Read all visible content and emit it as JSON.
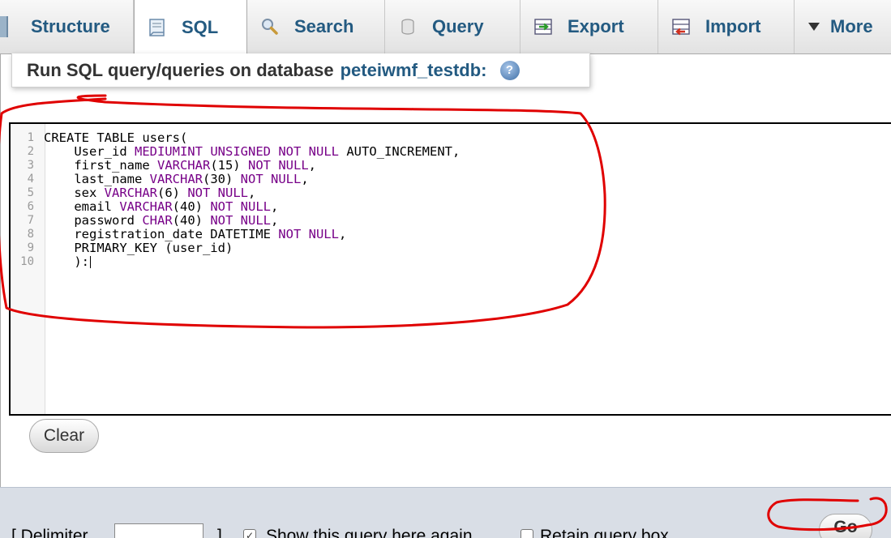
{
  "tabs": [
    {
      "label": "Structure",
      "icon": "table-structure-icon"
    },
    {
      "label": "SQL",
      "icon": "sql-document-icon",
      "active": true
    },
    {
      "label": "Search",
      "icon": "magnifier-icon"
    },
    {
      "label": "Query",
      "icon": "database-query-icon"
    },
    {
      "label": "Export",
      "icon": "export-icon"
    },
    {
      "label": "Import",
      "icon": "import-icon"
    },
    {
      "label": "More",
      "icon": "triangle-down-icon"
    }
  ],
  "heading": {
    "prefix": "Run SQL query/queries on database",
    "database": "peteiwmf_testdb:"
  },
  "editor": {
    "line_numbers": [
      "1",
      "2",
      "3",
      "4",
      "5",
      "6",
      "7",
      "8",
      "9",
      "10"
    ],
    "lines": [
      "CREATE TABLE users(",
      "    User_id MEDIUMINT UNSIGNED NOT NULL AUTO_INCREMENT,",
      "    first_name VARCHAR(15) NOT NULL,",
      "    last_name VARCHAR(30) NOT NULL,",
      "    sex VARCHAR(6) NOT NULL,",
      "    email VARCHAR(40) NOT NULL,",
      "    password CHAR(40) NOT NULL,",
      "    registration_date DATETIME NOT NULL,",
      "    PRIMARY_KEY (user_id)",
      "    ):"
    ],
    "keyword_color": "#770088"
  },
  "buttons": {
    "clear": "Clear",
    "go": "Go"
  },
  "options": {
    "delimiter_label_start": "[ Delimiter",
    "delimiter_label_end": "]",
    "show_query_label": "Show this query here again",
    "retain_box_label": "Retain query box"
  },
  "colors": {
    "link": "#235a81",
    "annotation": "#e00000",
    "bottom_bar": "#d9dee6"
  }
}
